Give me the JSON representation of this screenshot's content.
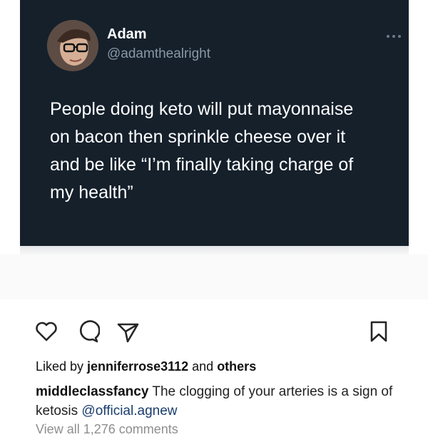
{
  "tweet": {
    "author_name": "Adam",
    "author_handle": "@adamthealright",
    "text": "People doing keto will put mayonnaise\non bacon then sprinkle cheese over it\nand be like “I’m finally taking charge of\nmy health”",
    "background_color": "#15202b",
    "avatar_icon": "avatar-photo",
    "more_icon": "more-horizontal-icon"
  },
  "post_actions": {
    "icons": [
      "heart-icon",
      "comment-icon",
      "share-icon",
      "bookmark-icon"
    ]
  },
  "likes": {
    "prefix": "Liked by ",
    "user": "jenniferrose3112",
    "middle": " and ",
    "others": "others"
  },
  "caption": {
    "username": "middleclassfancy",
    "text": " The clogging of your arteries is a sign of ketosis ",
    "mention": "@official.agnew"
  },
  "view_comments": "View all 1,276 comments"
}
